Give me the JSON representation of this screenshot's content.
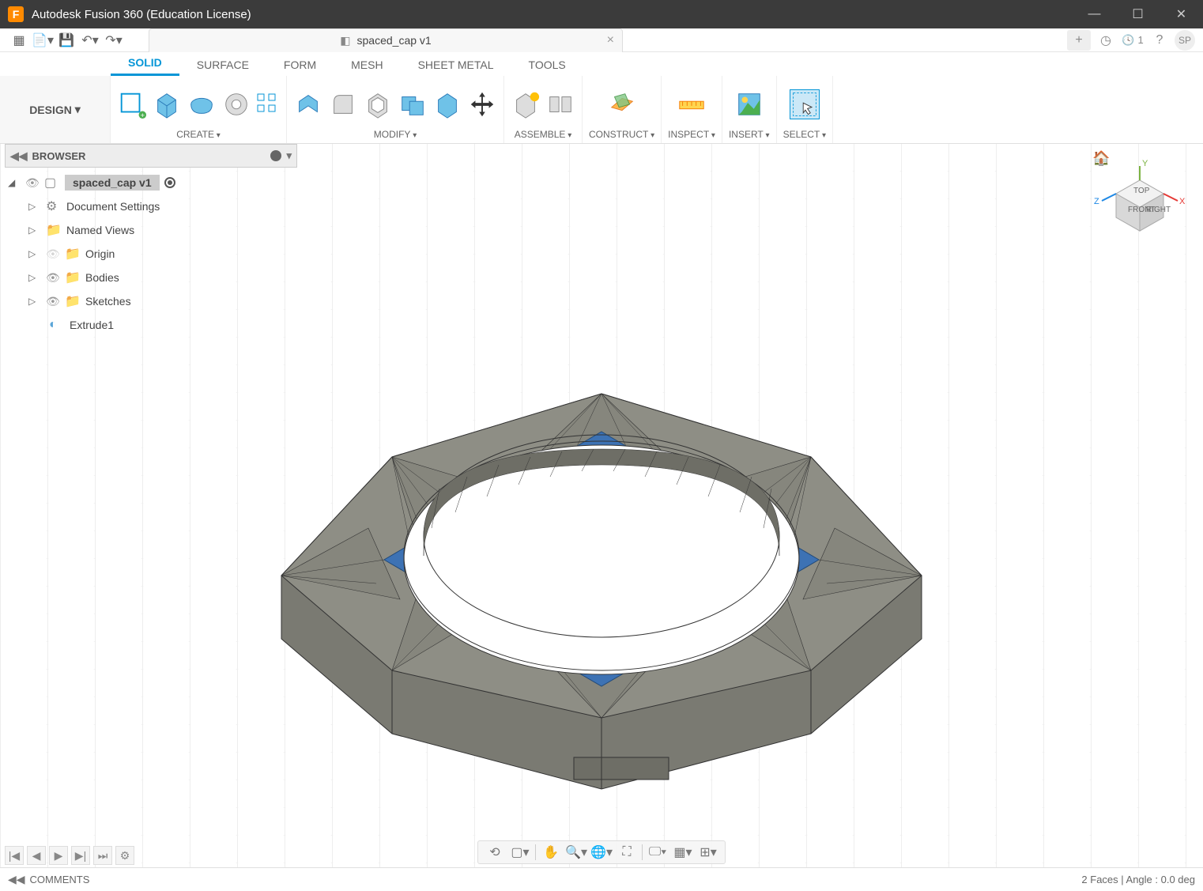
{
  "window": {
    "title": "Autodesk Fusion 360 (Education License)"
  },
  "tab": {
    "name": "spaced_cap v1"
  },
  "qat_right": {
    "jobs_count": "1",
    "avatar_initials": "SP"
  },
  "workspace": "DESIGN",
  "ribbon_tabs": [
    "SOLID",
    "SURFACE",
    "FORM",
    "MESH",
    "SHEET METAL",
    "TOOLS"
  ],
  "ribbon_active_tab": "SOLID",
  "ribbon_groups": {
    "create": "CREATE",
    "modify": "MODIFY",
    "assemble": "ASSEMBLE",
    "construct": "CONSTRUCT",
    "inspect": "INSPECT",
    "insert": "INSERT",
    "select": "SELECT"
  },
  "browser": {
    "title": "BROWSER",
    "root": "spaced_cap v1",
    "items": [
      "Document Settings",
      "Named Views",
      "Origin",
      "Bodies",
      "Sketches"
    ],
    "feature": "Extrude1"
  },
  "comments": "COMMENTS",
  "status": "2 Faces | Angle : 0.0 deg",
  "viewcube": {
    "front": "FRONT",
    "top": "TOP",
    "right": "RIGHT"
  }
}
